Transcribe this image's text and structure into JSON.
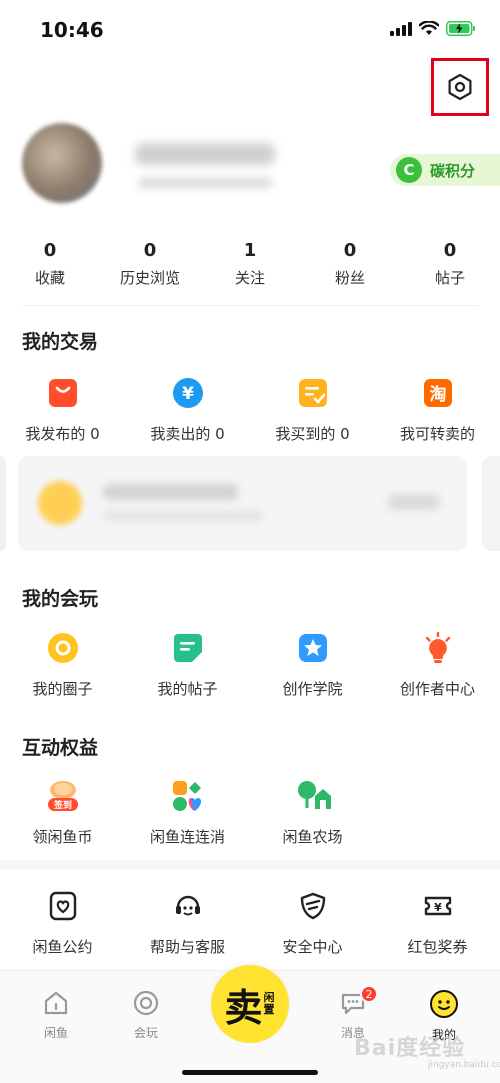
{
  "status_bar": {
    "time": "10:46"
  },
  "profile": {
    "carbon_icon_letter": "C",
    "carbon_label": "碳积分"
  },
  "stats": [
    {
      "value": "0",
      "label": "收藏"
    },
    {
      "value": "0",
      "label": "历史浏览"
    },
    {
      "value": "1",
      "label": "关注"
    },
    {
      "value": "0",
      "label": "粉丝"
    },
    {
      "value": "0",
      "label": "帖子"
    }
  ],
  "trade": {
    "title": "我的交易",
    "items": [
      {
        "label": "我发布的 0",
        "icon": "bag-icon",
        "color": "#ff4d2e"
      },
      {
        "label": "我卖出的 0",
        "icon": "yen-icon",
        "color": "#1e9bf0"
      },
      {
        "label": "我买到的 0",
        "icon": "check-doc-icon",
        "color": "#ffb21e"
      },
      {
        "label": "我可转卖的",
        "icon": "tao-icon",
        "color": "#ff6a00"
      }
    ]
  },
  "play": {
    "title": "我的会玩",
    "items": [
      {
        "label": "我的圈子",
        "icon": "circle-icon",
        "color": "#ffc21e"
      },
      {
        "label": "我的帖子",
        "icon": "post-icon",
        "color": "#28c08a"
      },
      {
        "label": "创作学院",
        "icon": "star-icon",
        "color": "#2f9bff"
      },
      {
        "label": "创作者中心",
        "icon": "bulb-icon",
        "color": "#ff5a2e"
      }
    ]
  },
  "benefits": {
    "title": "互动权益",
    "items": [
      {
        "label": "领闲鱼币",
        "icon": "coin-icon",
        "badge": "签到",
        "color": "#ff6a3d"
      },
      {
        "label": "闲鱼连连消",
        "icon": "puzzle-icon",
        "color": "#ff4d8a"
      },
      {
        "label": "闲鱼农场",
        "icon": "farm-icon",
        "color": "#2fb86a"
      }
    ]
  },
  "services": {
    "items": [
      {
        "label": "闲鱼公约",
        "icon": "heart-doc-icon"
      },
      {
        "label": "帮助与客服",
        "icon": "headset-icon"
      },
      {
        "label": "安全中心",
        "icon": "shield-icon"
      },
      {
        "label": "红包奖券",
        "icon": "ticket-icon"
      }
    ]
  },
  "tabbar": {
    "home": "闲鱼",
    "play": "会玩",
    "sell_main": "卖",
    "sell_side": "闲置",
    "messages": "消息",
    "messages_badge": "2",
    "mine": "我的"
  },
  "watermark": {
    "text": "Bai度经验",
    "sub": "jingyan.baidu.com"
  }
}
